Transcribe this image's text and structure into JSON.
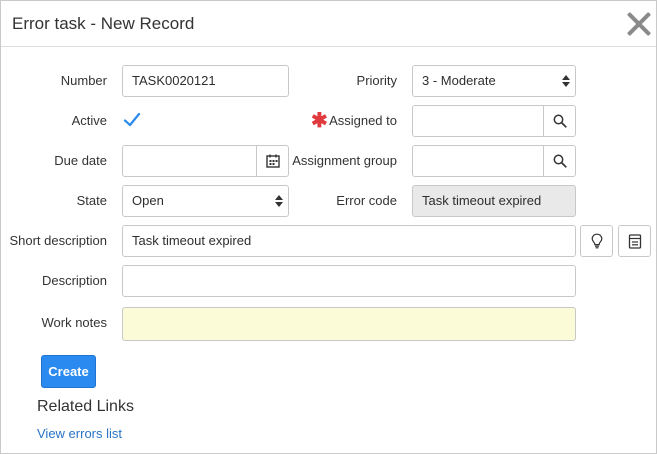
{
  "modal": {
    "title": "Error task - New Record"
  },
  "fields": {
    "number": {
      "label": "Number",
      "value": "TASK0020121"
    },
    "priority": {
      "label": "Priority",
      "value": "3 - Moderate"
    },
    "active": {
      "label": "Active",
      "checked": true
    },
    "assigned_to": {
      "label": "Assigned to",
      "value": "",
      "required": true
    },
    "due_date": {
      "label": "Due date",
      "value": ""
    },
    "assignment_group": {
      "label": "Assignment group",
      "value": ""
    },
    "state": {
      "label": "State",
      "value": "Open"
    },
    "error_code": {
      "label": "Error code",
      "value": "Task timeout expired"
    },
    "short_description": {
      "label": "Short description",
      "value": "Task timeout expired"
    },
    "description": {
      "label": "Description",
      "value": ""
    },
    "work_notes": {
      "label": "Work notes",
      "value": ""
    }
  },
  "buttons": {
    "create": "Create"
  },
  "related": {
    "heading": "Related Links",
    "links": [
      "View errors list"
    ]
  },
  "colors": {
    "primary": "#2b8af0",
    "link": "#2874c6",
    "required": "#e0393e",
    "work_notes_bg": "#fbfbd8",
    "readonly_bg": "#e9e9e9"
  },
  "icons": {
    "close": "close-icon",
    "search": "search-icon",
    "calendar": "calendar-icon",
    "lightbulb": "lightbulb-icon",
    "template": "template-icon",
    "check": "check-icon"
  }
}
